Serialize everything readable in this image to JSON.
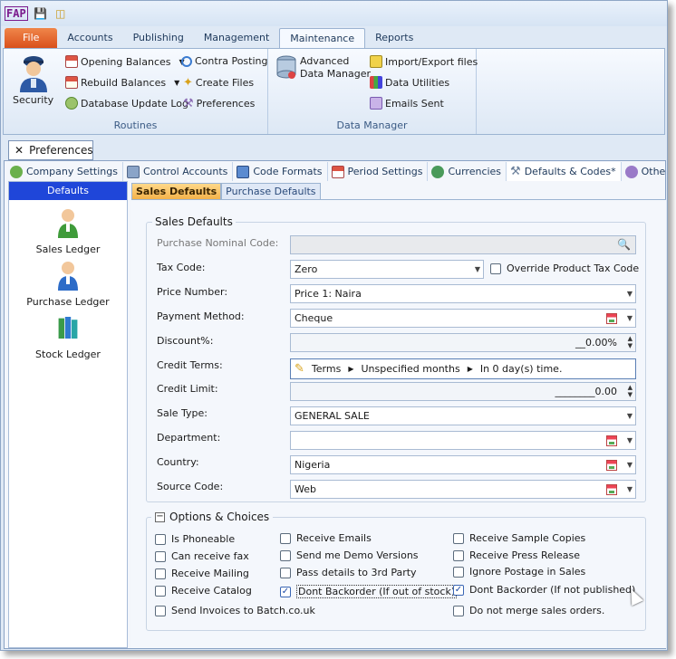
{
  "app": {
    "logo": "FAP"
  },
  "ribbon_tabs": [
    "File",
    "Accounts",
    "Publishing",
    "Management",
    "Maintenance",
    "Reports"
  ],
  "ribbon": {
    "routines": {
      "label": "Routines",
      "security": "Security",
      "opening_balances": "Opening Balances",
      "rebuild_balances": "Rebuild Balances",
      "db_update_log": "Database Update Log",
      "contra_posting": "Contra Posting",
      "create_files": "Create Files",
      "preferences": "Preferences"
    },
    "data_manager": {
      "label": "Data Manager",
      "advanced_1": "Advanced",
      "advanced_2": "Data Manager",
      "import_export": "Import/Export files",
      "data_utilities": "Data Utilities",
      "emails_sent": "Emails Sent"
    }
  },
  "doc_tab": {
    "label": "Preferences"
  },
  "option_tabs": [
    "Company Settings",
    "Control Accounts",
    "Code Formats",
    "Period Settings",
    "Currencies",
    "Defaults & Codes*",
    "Other Prefe"
  ],
  "left_panel": {
    "header": "Defaults",
    "items": [
      "Sales Ledger",
      "Purchase Ledger",
      "Stock Ledger"
    ]
  },
  "sub_tabs": [
    "Sales Defaults",
    "Purchase Defaults"
  ],
  "sales_defaults": {
    "title": "Sales Defaults",
    "purchase_nominal_code": {
      "label": "Purchase Nominal Code:",
      "value": ""
    },
    "tax_code": {
      "label": "Tax Code:",
      "value": "Zero"
    },
    "override_tax": "Override Product Tax Code",
    "price_number": {
      "label": "Price Number:",
      "value": "Price 1: Naira"
    },
    "payment_method": {
      "label": "Payment Method:",
      "value": "Cheque"
    },
    "discount": {
      "label": "Discount%:",
      "value": "__0.00%"
    },
    "credit_terms": {
      "label": "Credit Terms:",
      "terms": "Terms",
      "months": "Unspecified months",
      "days": "In 0 day(s) time."
    },
    "credit_limit": {
      "label": "Credit Limit:",
      "value": "________0.00"
    },
    "sale_type": {
      "label": "Sale Type:",
      "value": "GENERAL SALE"
    },
    "department": {
      "label": "Department:",
      "value": ""
    },
    "country": {
      "label": "Country:",
      "value": "Nigeria"
    },
    "source_code": {
      "label": "Source Code:",
      "value": "Web"
    }
  },
  "options": {
    "title": "Options & Choices",
    "collapse": "−",
    "items": [
      {
        "label": "Is Phoneable",
        "checked": false
      },
      {
        "label": "Can receive fax",
        "checked": false
      },
      {
        "label": "Receive Mailing",
        "checked": false
      },
      {
        "label": "Receive Catalog",
        "checked": false
      },
      {
        "label": "Send Invoices to Batch.co.uk",
        "checked": false
      },
      {
        "label": "Receive Emails",
        "checked": false
      },
      {
        "label": "Send me Demo Versions",
        "checked": false
      },
      {
        "label": "Pass details to 3rd Party",
        "checked": false
      },
      {
        "label": "Dont Backorder (If out of stock)",
        "checked": true
      },
      {
        "label": "Receive Sample Copies",
        "checked": false
      },
      {
        "label": "Receive Press Release",
        "checked": false
      },
      {
        "label": "Ignore Postage in Sales",
        "checked": false
      },
      {
        "label": "Dont Backorder (If not published)",
        "checked": true
      },
      {
        "label": "Do not merge sales orders.",
        "checked": false
      }
    ]
  },
  "check_mark": "✓",
  "colors": {
    "accent": "#1f46d9",
    "file_tab": "#d9501c"
  }
}
